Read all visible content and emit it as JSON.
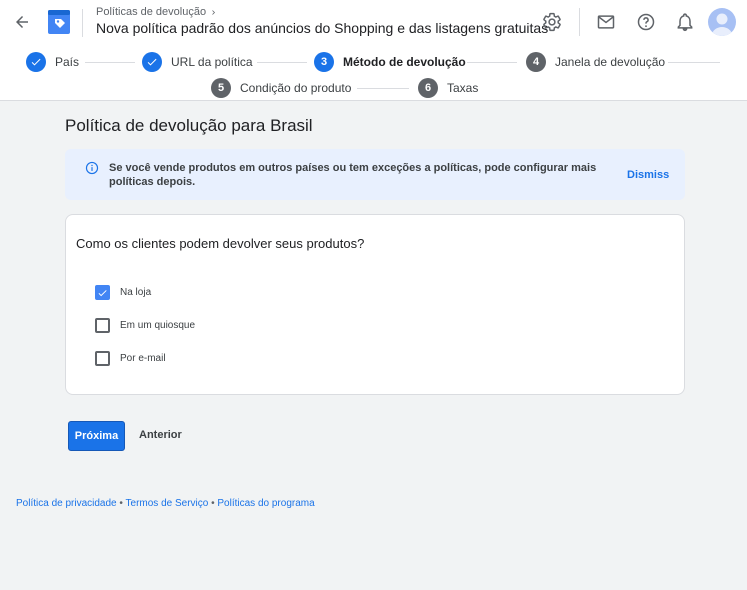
{
  "header": {
    "breadcrumb": "Políticas de devolução",
    "title": "Nova política padrão dos anúncios do Shopping e das listagens gratuitas",
    "icons": [
      "back-arrow-icon",
      "shopping-tag-icon",
      "gear-icon",
      "mail-icon",
      "help-icon",
      "bell-icon",
      "avatar"
    ]
  },
  "stepper": {
    "steps": [
      {
        "num": "",
        "label": "País",
        "state": "done"
      },
      {
        "num": "",
        "label": "URL da política",
        "state": "done"
      },
      {
        "num": "3",
        "label": "Método de devolução",
        "state": "active"
      },
      {
        "num": "4",
        "label": "Janela de devolução",
        "state": "pending"
      },
      {
        "num": "5",
        "label": "Condição do produto",
        "state": "pending"
      },
      {
        "num": "6",
        "label": "Taxas",
        "state": "pending"
      }
    ]
  },
  "main": {
    "section_title": "Política de devolução para Brasil",
    "info": {
      "text": "Se você vende produtos em outros países ou tem exceções a políticas, pode configurar mais políticas depois.",
      "dismiss_label": "Dismiss"
    },
    "question": "Como os clientes podem devolver seus produtos?",
    "options": [
      {
        "label": "Na loja",
        "checked": true
      },
      {
        "label": "Em um quiosque",
        "checked": false
      },
      {
        "label": "Por e-mail",
        "checked": false
      }
    ],
    "buttons": {
      "next": "Próxima",
      "previous": "Anterior"
    }
  },
  "footer": {
    "privacy": "Política de privacidade",
    "separator": " • ",
    "terms": "Termos de Serviço",
    "program": "Políticas do programa"
  },
  "colors": {
    "accent": "#1a73e8",
    "info_bg": "#e8f0fe",
    "page_bg": "#f1f3f4"
  }
}
